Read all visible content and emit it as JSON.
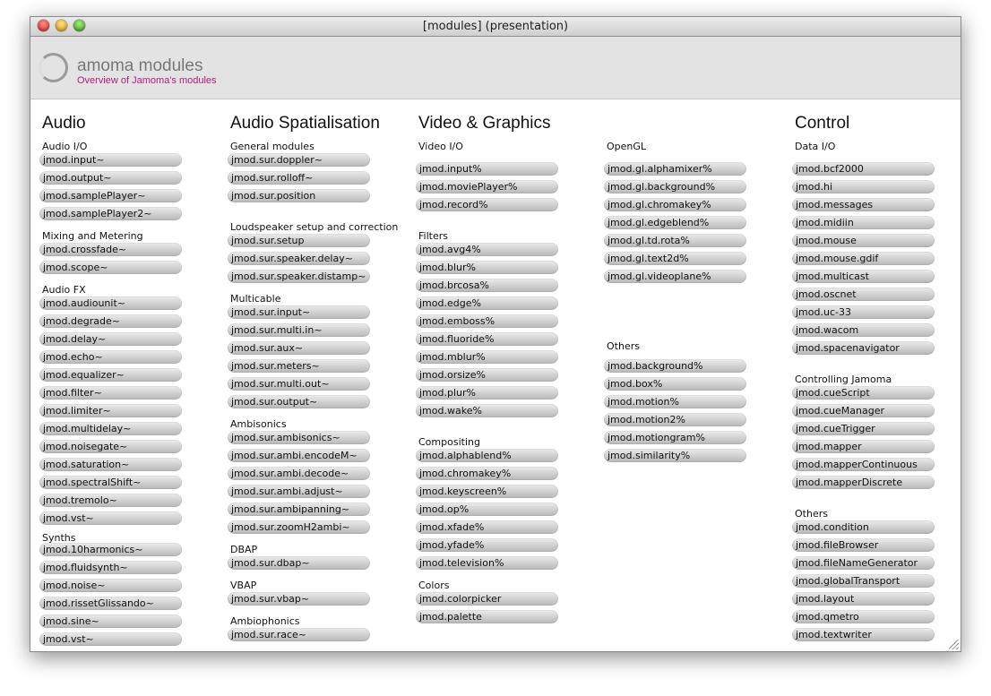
{
  "window": {
    "title": "[modules] (presentation)"
  },
  "header": {
    "title": "amoma modules",
    "subtitle": "Overview of Jamoma's modules"
  },
  "headings": {
    "audio": "Audio",
    "spatialisation": "Audio Spatialisation",
    "video": "Video & Graphics",
    "control": "Control"
  },
  "sections": {
    "audio_io": {
      "label": "Audio I/O",
      "modules": [
        "jmod.input~",
        "jmod.output~",
        "jmod.samplePlayer~",
        "jmod.samplePlayer2~"
      ]
    },
    "mixing": {
      "label": "Mixing and Metering",
      "modules": [
        "jmod.crossfade~",
        "jmod.scope~"
      ]
    },
    "audio_fx": {
      "label": "Audio FX",
      "modules": [
        "jmod.audiounit~",
        "jmod.degrade~",
        "jmod.delay~",
        "jmod.echo~",
        "jmod.equalizer~",
        "jmod.filter~",
        "jmod.limiter~",
        "jmod.multidelay~",
        "jmod.noisegate~",
        "jmod.saturation~",
        "jmod.spectralShift~",
        "jmod.tremolo~",
        "jmod.vst~"
      ]
    },
    "synths": {
      "label": "Synths",
      "modules": [
        "jmod.10harmonics~",
        "jmod.fluidsynth~",
        "jmod.noise~",
        "jmod.rissetGlissando~",
        "jmod.sine~",
        "jmod.vst~"
      ]
    },
    "general": {
      "label": "General modules",
      "modules": [
        "jmod.sur.doppler~",
        "jmod.sur.rolloff~",
        "jmod.sur.position"
      ]
    },
    "loudspeaker": {
      "label": "Loudspeaker setup and correction",
      "modules": [
        "jmod.sur.setup",
        "jmod.sur.speaker.delay~",
        "jmod.sur.speaker.distamp~"
      ]
    },
    "multicable": {
      "label": "Multicable",
      "modules": [
        "jmod.sur.input~",
        "jmod.sur.multi.in~",
        "jmod.sur.aux~",
        "jmod.sur.meters~",
        "jmod.sur.multi.out~",
        "jmod.sur.output~"
      ]
    },
    "ambisonics": {
      "label": "Ambisonics",
      "modules": [
        "jmod.sur.ambisonics~",
        "jmod.sur.ambi.encodeM~",
        "jmod.sur.ambi.decode~",
        "jmod.sur.ambi.adjust~",
        "jmod.sur.ambipanning~",
        "jmod.sur.zoomH2ambi~"
      ]
    },
    "dbap": {
      "label": "DBAP",
      "modules": [
        "jmod.sur.dbap~"
      ]
    },
    "vbap": {
      "label": "VBAP",
      "modules": [
        "jmod.sur.vbap~"
      ]
    },
    "ambiophonics": {
      "label": "Ambiophonics",
      "modules": [
        "jmod.sur.race~"
      ]
    },
    "video_io": {
      "label": "Video I/O",
      "modules": [
        "jmod.input%",
        "jmod.moviePlayer%",
        "jmod.record%"
      ]
    },
    "filters": {
      "label": "Filters",
      "modules": [
        "jmod.avg4%",
        "jmod.blur%",
        "jmod.brcosa%",
        "jmod.edge%",
        "jmod.emboss%",
        "jmod.fluoride%",
        "jmod.mblur%",
        "jmod.orsize%",
        "jmod.plur%",
        "jmod.wake%"
      ]
    },
    "compositing": {
      "label": "Compositing",
      "modules": [
        "jmod.alphablend%",
        "jmod.chromakey%",
        "jmod.keyscreen%",
        "jmod.op%",
        "jmod.xfade%",
        "jmod.yfade%",
        "jmod.television%"
      ]
    },
    "colors": {
      "label": "Colors",
      "modules": [
        "jmod.colorpicker",
        "jmod.palette"
      ]
    },
    "opengl": {
      "label": "OpenGL",
      "modules": [
        "jmod.gl.alphamixer%",
        "jmod.gl.background%",
        "jmod.gl.chromakey%",
        "jmod.gl.edgeblend%",
        "jmod.gl.td.rota%",
        "jmod.gl.text2d%",
        "jmod.gl.videoplane%"
      ]
    },
    "video_others": {
      "label": "Others",
      "modules": [
        "jmod.background%",
        "jmod.box%",
        "jmod.motion%",
        "jmod.motion2%",
        "jmod.motiongram%",
        "jmod.similarity%"
      ]
    },
    "data_io": {
      "label": "Data I/O",
      "modules": [
        "jmod.bcf2000",
        "jmod.hi",
        "jmod.messages",
        "jmod.midiin",
        "jmod.mouse",
        "jmod.mouse.gdif",
        "jmod.multicast",
        "jmod.oscnet",
        "jmod.uc-33",
        "jmod.wacom",
        "jmod.spacenavigator"
      ]
    },
    "controlling": {
      "label": "Controlling Jamoma",
      "modules": [
        "jmod.cueScript",
        "jmod.cueManager",
        "jmod.cueTrigger",
        "jmod.mapper",
        "jmod.mapperContinuous",
        "jmod.mapperDiscrete"
      ]
    },
    "control_others": {
      "label": "Others",
      "modules": [
        "jmod.condition",
        "jmod.fileBrowser",
        "jmod.fileNameGenerator",
        "jmod.globalTransport",
        "jmod.layout",
        "jmod.qmetro",
        "jmod.textwriter"
      ]
    }
  }
}
